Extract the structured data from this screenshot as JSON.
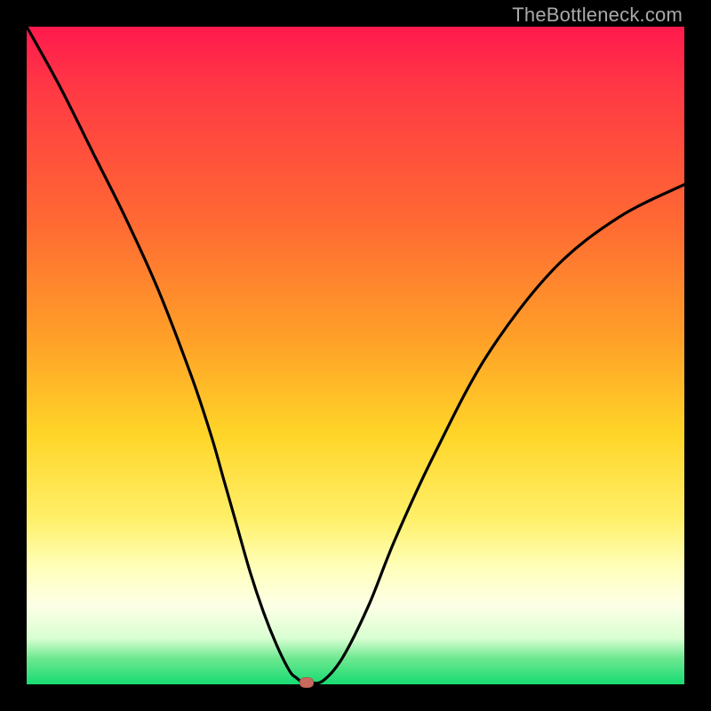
{
  "watermark": {
    "text": "TheBottleneck.com"
  },
  "colors": {
    "frame": "#000000",
    "gradient_top": "#ff1a4d",
    "gradient_mid": "#ffd528",
    "gradient_bottom": "#17db72",
    "curve_stroke": "#000000",
    "marker_fill": "#c76a5d"
  },
  "chart_data": {
    "type": "line",
    "title": "",
    "xlabel": "",
    "ylabel": "",
    "xlim": [
      0,
      100
    ],
    "ylim": [
      0,
      100
    ],
    "grid": false,
    "legend": false,
    "series": [
      {
        "name": "bottleneck-curve",
        "x": [
          0,
          5,
          10,
          15,
          20,
          25,
          28,
          30,
          32,
          34,
          36,
          38,
          40,
          41,
          42,
          43,
          45,
          48,
          52,
          56,
          62,
          70,
          80,
          90,
          100
        ],
        "y": [
          100,
          91,
          81,
          71,
          60,
          47,
          38,
          31,
          24,
          17,
          11,
          6,
          2,
          1,
          0.3,
          0.3,
          0.5,
          4,
          12,
          22,
          35,
          50,
          63,
          71,
          76
        ]
      }
    ],
    "marker": {
      "x": 42.5,
      "y": 0.3,
      "label": "optimal-point"
    }
  }
}
